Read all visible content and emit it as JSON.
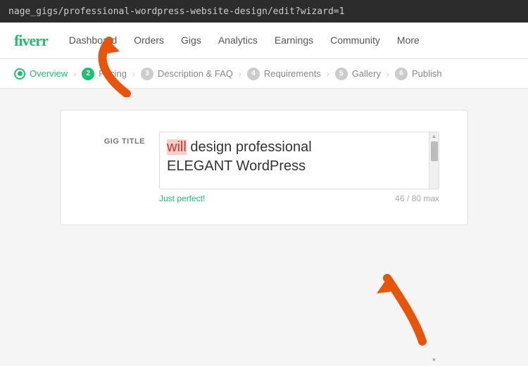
{
  "url_bar": {
    "text": "nage_gigs/professional-wordpress-website-design/edit?wizard=1"
  },
  "navbar": {
    "logo": "fiverr",
    "links": [
      {
        "id": "dashboard",
        "label": "Dashboard"
      },
      {
        "id": "orders",
        "label": "Orders"
      },
      {
        "id": "gigs",
        "label": "Gigs"
      },
      {
        "id": "analytics",
        "label": "Analytics"
      },
      {
        "id": "earnings",
        "label": "Earnings"
      },
      {
        "id": "community",
        "label": "Community"
      },
      {
        "id": "more",
        "label": "More"
      }
    ]
  },
  "breadcrumb": {
    "steps": [
      {
        "id": "overview",
        "label": "Overview",
        "number": "",
        "active": true
      },
      {
        "id": "pricing",
        "label": "Pricing",
        "number": "2",
        "active": false
      },
      {
        "id": "description-faq",
        "label": "Description & FAQ",
        "number": "3",
        "active": false
      },
      {
        "id": "requirements",
        "label": "Requirements",
        "number": "4",
        "active": false
      },
      {
        "id": "gallery",
        "label": "Gallery",
        "number": "5",
        "active": false
      },
      {
        "id": "publish",
        "label": "Publish",
        "number": "6",
        "active": false
      }
    ]
  },
  "form": {
    "label": "GIG TITLE",
    "title_line1": "design professional",
    "title_line2": "ELEGANT WordPress",
    "highlighted_word": "will",
    "feedback": "Just perfect!",
    "char_count": "46 / 80 max"
  },
  "colors": {
    "green": "#1dbf73",
    "orange": "#e8540a",
    "red_highlight": "#ffcccc"
  }
}
